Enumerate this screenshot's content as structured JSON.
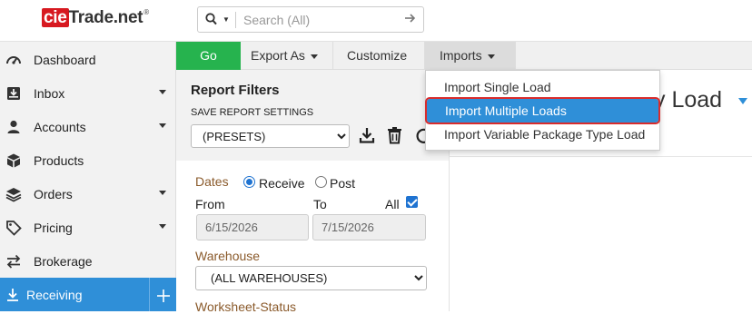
{
  "app": {
    "logo_brand": "cie",
    "logo_rest": "Trade.net",
    "logo_mark": "®"
  },
  "search": {
    "placeholder": "Search (All)",
    "icon": "search-icon"
  },
  "sidebar": {
    "items": [
      {
        "label": "Dashboard",
        "icon": "dashboard-icon",
        "has_dropdown": false
      },
      {
        "label": "Inbox",
        "icon": "inbox-icon",
        "has_dropdown": true
      },
      {
        "label": "Accounts",
        "icon": "user-icon",
        "has_dropdown": true
      },
      {
        "label": "Products",
        "icon": "cube-icon",
        "has_dropdown": false
      },
      {
        "label": "Orders",
        "icon": "layers-icon",
        "has_dropdown": true
      },
      {
        "label": "Pricing",
        "icon": "tag-icon",
        "has_dropdown": true
      },
      {
        "label": "Brokerage",
        "icon": "exchange-icon",
        "has_dropdown": false
      },
      {
        "label": "Receiving",
        "icon": "download-icon",
        "active": true
      }
    ],
    "active_color": "#2f8fd8"
  },
  "toolbar": {
    "go_label": "Go",
    "export_label": "Export As",
    "customize_label": "Customize",
    "imports_label": "Imports",
    "go_color": "#26b34e"
  },
  "imports_menu": {
    "items": [
      "Import Single Load",
      "Import Multiple Loads",
      "Import Variable Package Type Load"
    ],
    "highlighted_index": 1
  },
  "filters": {
    "title": "Report Filters",
    "save_settings_label": "SAVE REPORT SETTINGS",
    "preset_value": "(PRESETS)",
    "dates_label": "Dates",
    "receive_label": "Receive",
    "post_label": "Post",
    "date_mode": "Receive",
    "from_label": "From",
    "to_label": "To",
    "all_label": "All",
    "all_checked": true,
    "from_value": "6/15/2026",
    "to_value": "7/15/2026",
    "warehouse_label": "Warehouse",
    "warehouse_value": "(ALL WAREHOUSES)",
    "worksheet_status_label": "Worksheet-Status"
  },
  "report": {
    "title_partial": "y Load"
  }
}
